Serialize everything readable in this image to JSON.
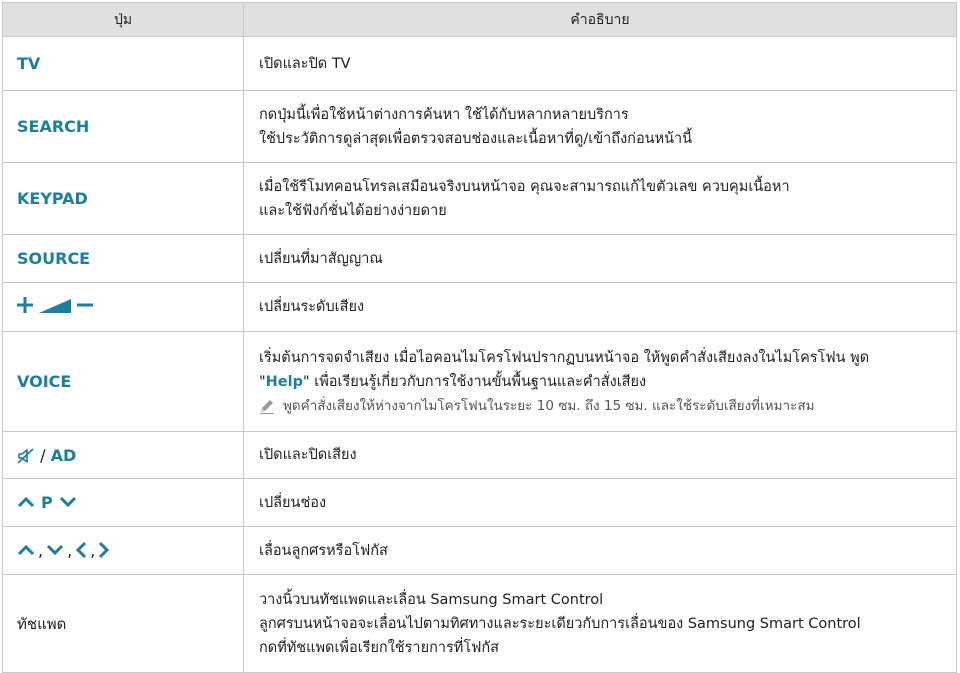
{
  "headers": {
    "button": "ปุ่ม",
    "description": "คำอธิบาย"
  },
  "rows": {
    "tv": {
      "key": "TV",
      "desc": [
        "เปิดและปิด TV"
      ]
    },
    "search": {
      "key": "SEARCH",
      "desc": [
        "กดปุ่มนี้เพื่อใช้หน้าต่างการค้นหา ใช้ได้กับหลากหลายบริการ",
        "ใช้ประวัติการดูล่าสุดเพื่อตรวจสอบช่องและเนื้อหาที่ดู/เข้าถึงก่อนหน้านี้"
      ]
    },
    "keypad": {
      "key": "KEYPAD",
      "desc": [
        "เมื่อใช้รีโมทคอนโทรลเสมือนจริงบนหน้าจอ คุณจะสามารถแก้ไขตัวเลข ควบคุมเนื้อหา",
        "และใช้ฟังก์ชั่นได้อย่างง่ายดาย"
      ]
    },
    "source": {
      "key": "SOURCE",
      "desc": [
        "เปลี่ยนที่มาสัญญาณ"
      ]
    },
    "volume": {
      "icons": [
        "plus-icon",
        "volume-ramp-icon",
        "minus-icon"
      ],
      "desc": [
        "เปลี่ยนระดับเสียง"
      ]
    },
    "voice": {
      "key": "VOICE",
      "desc_line1": "เริ่มต้นการจดจำเสียง เมื่อไอคอนไมโครโฟนปรากฏบนหน้าจอ ให้พูดคำสั่งเสียงลงในไมโครโฟน พูด",
      "quote_open": "\"",
      "help_word": "Help",
      "quote_close": "\"",
      "desc_line2_rest": " เพื่อเรียนรู้เกี่ยวกับการใช้งานขั้นพื้นฐานและคำสั่งเสียง",
      "note": "พูดคำสั่งเสียงให้ห่างจากไมโครโฟนในระยะ 10 ซม. ถึง 15 ซม. และใช้ระดับเสียงที่เหมาะสม",
      "note_icon": "pencil-icon"
    },
    "ad": {
      "separator": " / ",
      "key": "AD",
      "icon": "mute-icon",
      "desc": [
        "เปิดและปิดเสียง"
      ]
    },
    "channel": {
      "key": "P",
      "icons": [
        "chevron-up-icon",
        "chevron-down-icon"
      ],
      "desc": [
        "เปลี่ยนช่อง"
      ]
    },
    "nav": {
      "separator": ",",
      "icons": [
        "chevron-up-icon",
        "chevron-down-icon",
        "chevron-left-icon",
        "chevron-right-icon"
      ],
      "desc": [
        "เลื่อนลูกศรหรือโฟกัส"
      ]
    },
    "touchpad": {
      "key": "ทัชแพด",
      "desc": [
        "วางนิ้วบนทัชแพดและเลื่อน Samsung Smart Control",
        "ลูกศรบนหน้าจอจะเลื่อนไปตามทิศทางและระยะเดียวกับการเลื่อนของ Samsung Smart Control",
        "กดที่ทัชแพดเพื่อเรียกใช้รายการที่โฟกัส"
      ]
    }
  },
  "colors": {
    "accent": "#1b7f9f",
    "header_bg": "#e0e0e0",
    "border": "#c9c9c9"
  }
}
